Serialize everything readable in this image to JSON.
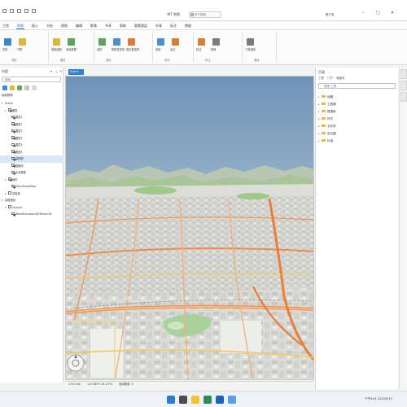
{
  "window": {
    "title": "ЖТ 地图",
    "search_placeholder": "命令搜索",
    "user": "账户名"
  },
  "ribbon": {
    "tabs": [
      "工程",
      "地图",
      "插入",
      "分析",
      "视图",
      "编辑",
      "影像",
      "共享",
      "帮助",
      "要素图层",
      "外观",
      "标注",
      "数据"
    ],
    "active_tab": "地图",
    "groups": [
      {
        "label": "导航",
        "buttons": [
          "浏览",
          "书签"
        ]
      },
      {
        "label": "图层",
        "buttons": [
          "基础底图",
          "添加数据"
        ]
      },
      {
        "label": "选择",
        "buttons": [
          "选择",
          "按属性选择",
          "按位置选择"
        ]
      },
      {
        "label": "查询",
        "buttons": [
          "测量",
          "定位"
        ]
      },
      {
        "label": "标注",
        "buttons": [
          "标注",
          "转换"
        ]
      },
      {
        "label": "离线",
        "buttons": [
          "下载地图"
        ]
      }
    ]
  },
  "contents": {
    "title": "内容",
    "search_placeholder": "搜索",
    "section": "绘制顺序",
    "tree": [
      {
        "label": "Scene",
        "depth": 0,
        "checked": false,
        "expander": "▾"
      },
      {
        "label": "图层",
        "depth": 1,
        "checked": true,
        "expander": "▾"
      },
      {
        "label": "图层1",
        "depth": 2,
        "checked": true,
        "expander": ""
      },
      {
        "label": "图层2",
        "depth": 2,
        "checked": true,
        "expander": ""
      },
      {
        "label": "图层3",
        "depth": 2,
        "checked": true,
        "expander": ""
      },
      {
        "label": "图层4",
        "depth": 2,
        "checked": true,
        "expander": ""
      },
      {
        "label": "图层5",
        "depth": 2,
        "checked": true,
        "expander": ""
      },
      {
        "label": "图层6",
        "depth": 2,
        "checked": true,
        "expander": ""
      },
      {
        "label": "建筑物",
        "depth": 2,
        "checked": true,
        "expander": "",
        "selected": true
      },
      {
        "label": "道路网",
        "depth": 2,
        "checked": true,
        "expander": ""
      },
      {
        "label": "水系数据",
        "depth": 2,
        "checked": true,
        "expander": ""
      },
      {
        "label": "地形",
        "depth": 1,
        "checked": true,
        "expander": "▾"
      },
      {
        "label": "OpenStreetMap",
        "depth": 2,
        "checked": true,
        "expander": ""
      },
      {
        "label": "高程源",
        "depth": 1,
        "checked": false,
        "expander": "▸"
      },
      {
        "label": "高程表面",
        "depth": 0,
        "checked": false,
        "expander": "▾"
      },
      {
        "label": "Ground",
        "depth": 1,
        "checked": false,
        "expander": "▾"
      },
      {
        "label": "WorldElevation3D/Terrain3D",
        "depth": 2,
        "checked": true,
        "expander": ""
      }
    ]
  },
  "map": {
    "tab_label": "Scene",
    "status_scale": "1:50,000",
    "status_coords": "120.68°E 24.15°N",
    "status_extra": "选择要素: 0"
  },
  "catalog": {
    "title": "目录",
    "subtabs": [
      "工程",
      "门户",
      "收藏夹"
    ],
    "search_placeholder": "搜索 工程",
    "items": [
      "地图",
      "工具箱",
      "数据库",
      "样式",
      "文件夹",
      "定位器",
      "标准"
    ]
  },
  "taskbar": {
    "time": "下午9:41",
    "date": "2023/5/12"
  },
  "colors": {
    "accent": "#2f7ed8",
    "folder": "#e8b93b",
    "sky_top": "#7f9fbf",
    "sky_bottom": "#dfe6ea",
    "road": "#f0924e",
    "green": "#a9cf8f"
  }
}
